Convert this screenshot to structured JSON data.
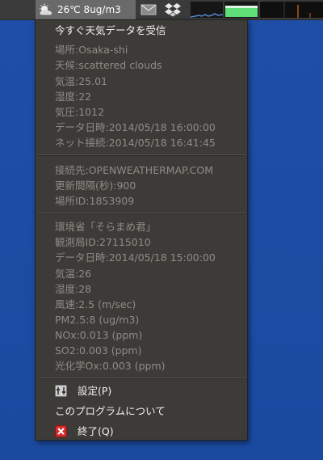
{
  "panel": {
    "weather_label": "26℃  8ug/m3"
  },
  "menu": {
    "receive_now": "今すぐ天気データを受信",
    "weather": [
      "場所:Osaka-shi",
      "天候:scattered clouds",
      "気温:25.01",
      "湿度:22",
      "気圧:1012",
      "データ日時:2014/05/18 16:00:00",
      "ネット接続:2014/05/18 16:41:45"
    ],
    "connection": [
      "接続先:OPENWEATHERMAP.COM",
      "更新間隔(秒):900",
      "場所ID:1853909"
    ],
    "soramame": [
      "環境省「そらまめ君」",
      "観測局ID:27115010",
      "データ日時:2014/05/18 15:00:00",
      "気温:26",
      "湿度:28",
      "風速:2.5 (m/sec)",
      "PM2.5:8 (ug/m3)",
      "NOx:0.013 (ppm)",
      "SO2:0.003 (ppm)",
      "光化学Ox:0.003 (ppm)"
    ],
    "settings": "設定(P)",
    "about": "このプログラムについて",
    "quit": "終了(Q)"
  },
  "icons": {
    "panel": [
      "cloud-icon",
      "mail-icon",
      "dropbox-icon"
    ],
    "menu": [
      "settings-icon",
      "quit-icon"
    ]
  },
  "colors": {
    "desktop": "#1f4fa8",
    "menu_bg": "#3c3b37",
    "menu_text_active": "#f2f1ef",
    "menu_text_disabled": "#8e8c87",
    "quit_icon": "#d42b2b",
    "memory_bar": "#5fdf77"
  }
}
